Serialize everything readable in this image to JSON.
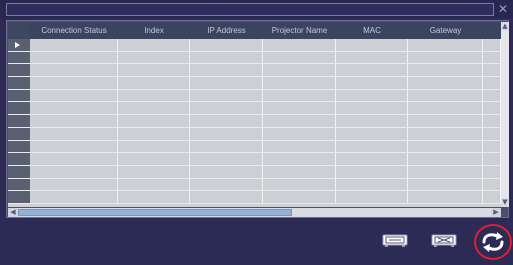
{
  "window": {
    "title": "",
    "close_glyph": "✕"
  },
  "table": {
    "columns": [
      "Connection Status",
      "Index",
      "IP Address",
      "Projector Name",
      "MAC",
      "Gateway",
      ""
    ],
    "row_count": 13,
    "selected_row": 0
  },
  "toolbar": {
    "buttons": [
      {
        "name": "connect-projector-button",
        "icon": "projector-connect-icon"
      },
      {
        "name": "disconnect-projector-button",
        "icon": "projector-disconnect-icon"
      },
      {
        "name": "refresh-button",
        "icon": "refresh-arrows-icon",
        "highlight_color": "#e0202c"
      }
    ]
  },
  "colors": {
    "background": "#2b2b55",
    "header": "#3c4360",
    "cell": "#cdcfd4",
    "scroll_thumb": "#8fb3da"
  }
}
